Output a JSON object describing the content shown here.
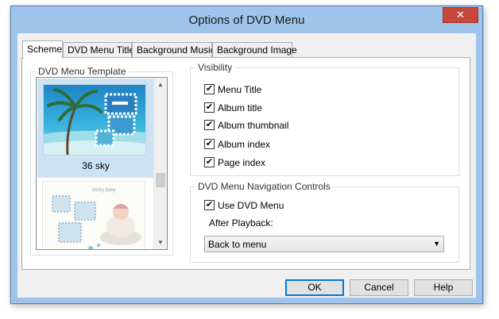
{
  "window": {
    "title": "Options of DVD Menu",
    "close_symbol": "✕"
  },
  "tabs": [
    {
      "label": "Scheme",
      "active": true
    },
    {
      "label": "DVD Menu Title",
      "active": false
    },
    {
      "label": "Background Music",
      "active": false
    },
    {
      "label": "Background Image",
      "active": false
    }
  ],
  "templates": {
    "legend": "DVD Menu Template",
    "items": [
      {
        "label": "36 sky",
        "selected": true
      },
      {
        "label": "",
        "selected": false
      }
    ],
    "thumb2_caption": "sticky baby"
  },
  "visibility": {
    "legend": "Visibility",
    "items": [
      {
        "label": "Menu Title",
        "checked": true
      },
      {
        "label": "Album title",
        "checked": true
      },
      {
        "label": "Album thumbnail",
        "checked": true
      },
      {
        "label": "Album index",
        "checked": true
      },
      {
        "label": "Page index",
        "checked": true
      }
    ]
  },
  "navigation": {
    "legend": "DVD Menu Navigation Controls",
    "use_dvd_menu": {
      "label": "Use DVD Menu",
      "checked": true
    },
    "after_playback_label": "After Playback:",
    "after_playback_value": "Back to menu"
  },
  "buttons": {
    "ok": "OK",
    "cancel": "Cancel",
    "help": "Help"
  },
  "icons": {
    "check": "✔",
    "scroll_up": "▲",
    "scroll_down": "▼",
    "dropdown": "▼"
  }
}
